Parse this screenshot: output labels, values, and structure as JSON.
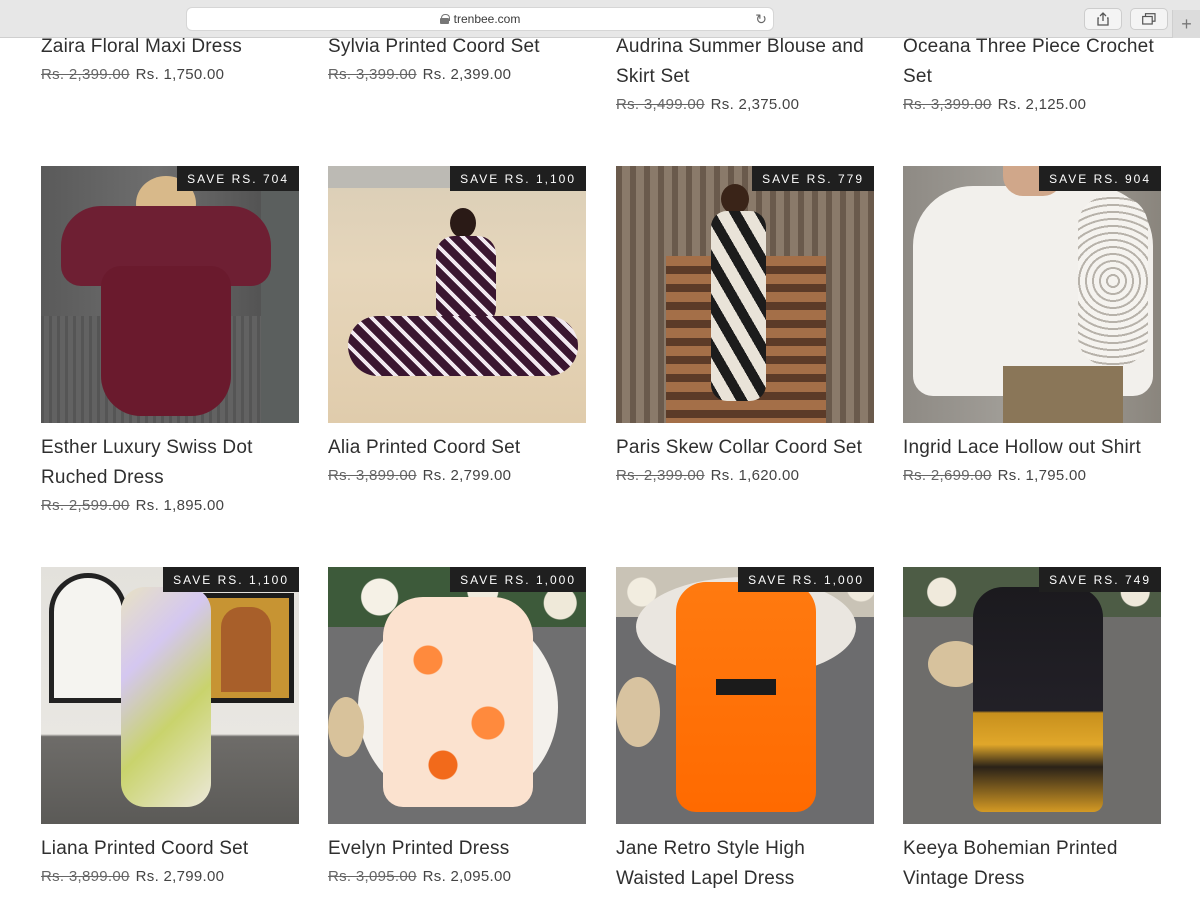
{
  "browser": {
    "url": "trenbee.com",
    "icons": [
      "lock-icon",
      "reload-icon",
      "share-icon",
      "tabs-icon",
      "new-tab-icon"
    ]
  },
  "products": [
    {
      "name": "Zaira Floral Maxi Dress",
      "old_price": "Rs. 2,399.00",
      "price": "Rs. 1,750.00",
      "badge": ""
    },
    {
      "name": "Sylvia Printed Coord Set",
      "old_price": "Rs. 3,399.00",
      "price": "Rs. 2,399.00",
      "badge": ""
    },
    {
      "name": "Audrina Summer Blouse and Skirt Set",
      "old_price": "Rs. 3,499.00",
      "price": "Rs. 2,375.00",
      "badge": ""
    },
    {
      "name": "Oceana Three Piece Crochet Set",
      "old_price": "Rs. 3,399.00",
      "price": "Rs. 2,125.00",
      "badge": ""
    },
    {
      "name": "Esther Luxury Swiss Dot Ruched Dress",
      "old_price": "Rs. 2,599.00",
      "price": "Rs. 1,895.00",
      "badge": "SAVE RS. 704"
    },
    {
      "name": "Alia Printed Coord Set",
      "old_price": "Rs. 3,899.00",
      "price": "Rs. 2,799.00",
      "badge": "SAVE RS. 1,100"
    },
    {
      "name": "Paris Skew Collar Coord Set",
      "old_price": "Rs. 2,399.00",
      "price": "Rs. 1,620.00",
      "badge": "SAVE RS. 779"
    },
    {
      "name": "Ingrid Lace Hollow out Shirt",
      "old_price": "Rs. 2,699.00",
      "price": "Rs. 1,795.00",
      "badge": "SAVE RS. 904"
    },
    {
      "name": "Liana Printed Coord Set",
      "old_price": "Rs. 3,899.00",
      "price": "Rs. 2,799.00",
      "badge": "SAVE RS. 1,100"
    },
    {
      "name": "Evelyn Printed Dress",
      "old_price": "Rs. 3,095.00",
      "price": "Rs. 2,095.00",
      "badge": "SAVE RS. 1,000"
    },
    {
      "name": "Jane Retro Style High Waisted Lapel Dress",
      "old_price": "",
      "price": "",
      "badge": "SAVE RS. 1,000"
    },
    {
      "name": "Keeya Bohemian Printed Vintage Dress",
      "old_price": "",
      "price": "",
      "badge": "SAVE RS. 749"
    }
  ]
}
